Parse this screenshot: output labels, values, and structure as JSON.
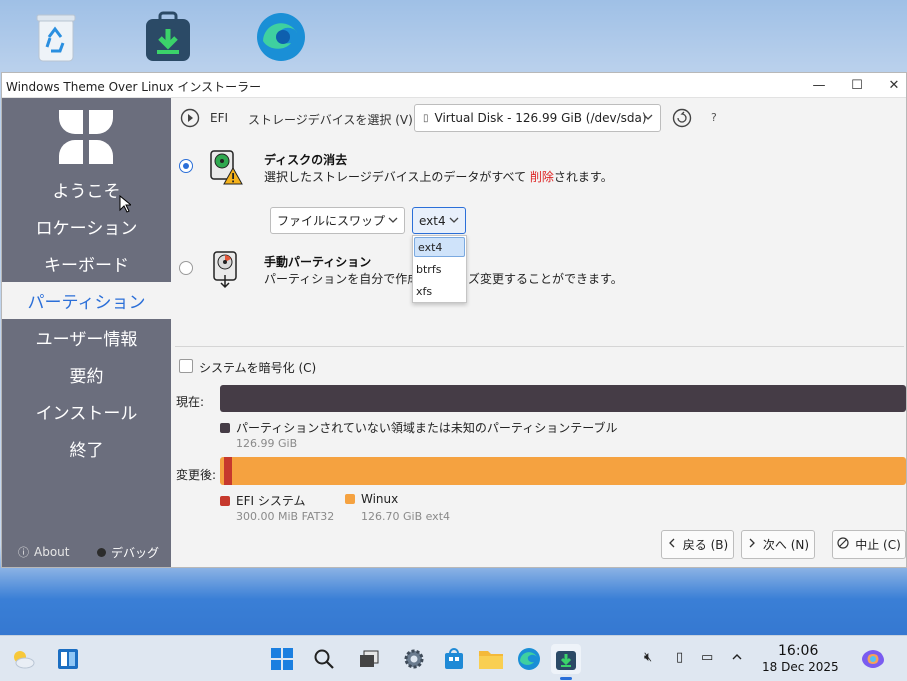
{
  "desktop": {
    "icons": [
      "recycle-bin-icon",
      "installer-icon",
      "edge-icon"
    ]
  },
  "window": {
    "title": "Windows Theme Over Linux インストーラー",
    "controls": {
      "minimize": "—",
      "maximize": "☐",
      "close": "✕"
    }
  },
  "sidebar": {
    "items": [
      {
        "label": "ようこそ"
      },
      {
        "label": "ロケーション"
      },
      {
        "label": "キーボード"
      },
      {
        "label": "パーティション",
        "active": true
      },
      {
        "label": "ユーザー情報"
      },
      {
        "label": "要約"
      },
      {
        "label": "インストール"
      },
      {
        "label": "終了"
      }
    ],
    "about": "About",
    "debug": "デバッグ"
  },
  "partition": {
    "efi_label": "EFI",
    "device_label": "ストレージデバイスを選択 (V):",
    "device_value": "Virtual Disk - 126.99 GiB (/dev/sda)",
    "help": "?",
    "erase_title": "ディスクの消去",
    "erase_desc_before": "選択したストレージデバイス上のデータがすべて ",
    "erase_desc_danger": "削除",
    "erase_desc_after": "されます。",
    "swap_value": "ファイルにスワップ",
    "fs_value": "ext4",
    "fs_options": [
      "ext4",
      "btrfs",
      "xfs"
    ],
    "manual_title": "手動パーティション",
    "manual_desc_1": "パーティションを自分で作成",
    "manual_desc_2": "ズ変更することができます。",
    "encrypt_label": "システムを暗号化 (C)",
    "current_label": "現在:",
    "after_label": "変更後:",
    "current_legend": "パーティションされていない領域または未知のパーティションテーブル",
    "current_size": "126.99 GiB",
    "after_legend": [
      {
        "name": "EFI システム",
        "detail": "300.00 MiB  FAT32",
        "color": "#c6392d"
      },
      {
        "name": "Winux",
        "detail": "126.70 GiB  ext4",
        "color": "#f5a240"
      }
    ],
    "current_color": "#453c46"
  },
  "buttons": {
    "back": "戻る (B)",
    "next": "次へ (N)",
    "cancel": "中止 (C)"
  },
  "taskbar": {
    "time": "16:06",
    "date": "18 Dec 2025"
  }
}
